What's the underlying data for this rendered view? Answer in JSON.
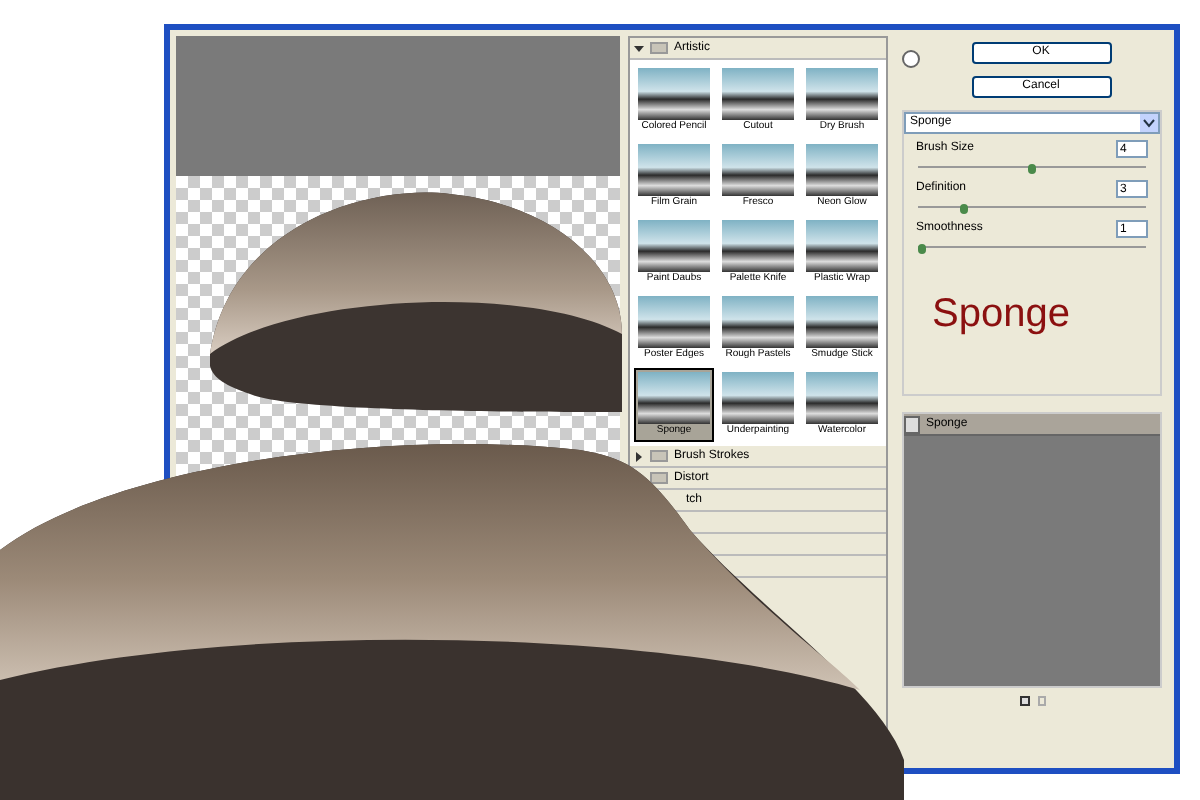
{
  "categories": [
    {
      "label": "Artistic",
      "expanded": true,
      "filters": [
        {
          "label": "Colored Pencil",
          "selected": false
        },
        {
          "label": "Cutout",
          "selected": false
        },
        {
          "label": "Dry Brush",
          "selected": false
        },
        {
          "label": "Film Grain",
          "selected": false
        },
        {
          "label": "Fresco",
          "selected": false
        },
        {
          "label": "Neon Glow",
          "selected": false
        },
        {
          "label": "Paint Daubs",
          "selected": false
        },
        {
          "label": "Palette Knife",
          "selected": false
        },
        {
          "label": "Plastic Wrap",
          "selected": false
        },
        {
          "label": "Poster Edges",
          "selected": false
        },
        {
          "label": "Rough Pastels",
          "selected": false
        },
        {
          "label": "Smudge Stick",
          "selected": false
        },
        {
          "label": "Sponge",
          "selected": true
        },
        {
          "label": "Underpainting",
          "selected": false
        },
        {
          "label": "Watercolor",
          "selected": false
        }
      ]
    },
    {
      "label": "Brush Strokes",
      "expanded": false
    },
    {
      "label": "Distort",
      "expanded": false
    },
    {
      "label": "tch"
    }
  ],
  "buttons": [
    "OK",
    "Cancel"
  ],
  "filter_select": "Sponge",
  "params": [
    {
      "label": "Brush Size",
      "value": "4",
      "level": 0.5
    },
    {
      "label": "Definition",
      "value": "3",
      "level": 0.2
    },
    {
      "label": "Smoothness",
      "value": "1",
      "level": 0
    }
  ],
  "filter_title": "Sponge",
  "layers": [
    {
      "label": "Sponge"
    }
  ]
}
